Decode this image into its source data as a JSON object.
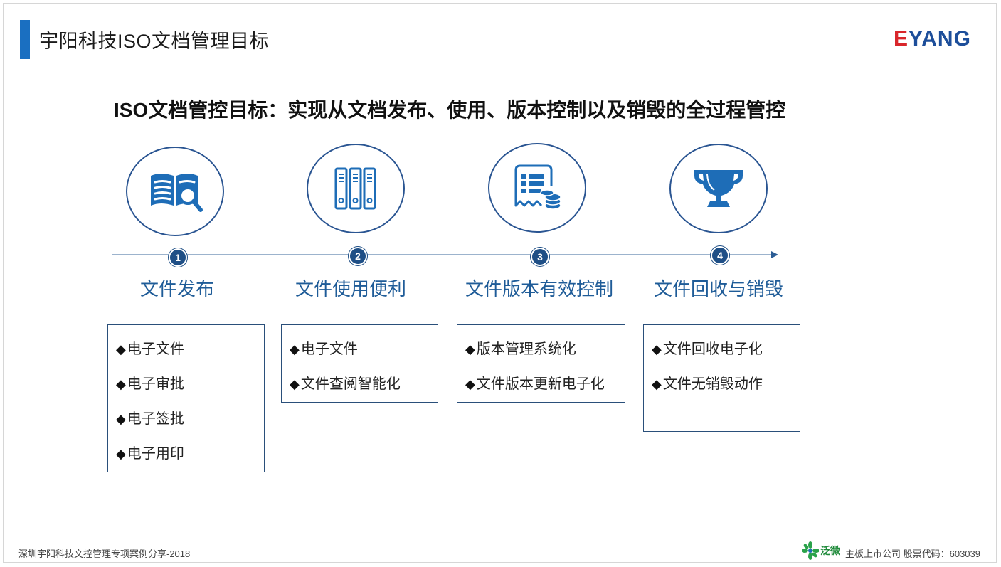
{
  "header": {
    "title": "宇阳科技ISO文档管理目标",
    "logo_e": "E",
    "logo_rest": "YANG",
    "accent_color": "#1a6fc1"
  },
  "headline": "ISO文档管控目标：实现从文档发布、使用、版本控制以及销毁的全过程管控",
  "steps": [
    {
      "number": "1",
      "label": "文件发布",
      "icon": "book-search-icon",
      "items": [
        "电子文件",
        "电子审批",
        "电子签批",
        "电子用印"
      ]
    },
    {
      "number": "2",
      "label": "文件使用便利",
      "icon": "binders-icon",
      "items": [
        "电子文件",
        "文件查阅智能化"
      ]
    },
    {
      "number": "3",
      "label": "文件版本有效控制",
      "icon": "receipt-coins-icon",
      "items": [
        "版本管理系统化",
        "文件版本更新电子化"
      ]
    },
    {
      "number": "4",
      "label": "文件回收与销毁",
      "icon": "trophy-icon",
      "items": [
        "文件回收电子化",
        "文件无销毁动作"
      ]
    }
  ],
  "bullet": "◆",
  "footer": {
    "left": "深圳宇阳科技文控管理专项案例分享-2018",
    "brand": "泛微",
    "right": "主板上市公司  股票代码：603039"
  },
  "colors": {
    "circle_border": "#2a5592",
    "label": "#1f5c98",
    "icon": "#1e6db7",
    "step_badge": "#1f4f86"
  }
}
